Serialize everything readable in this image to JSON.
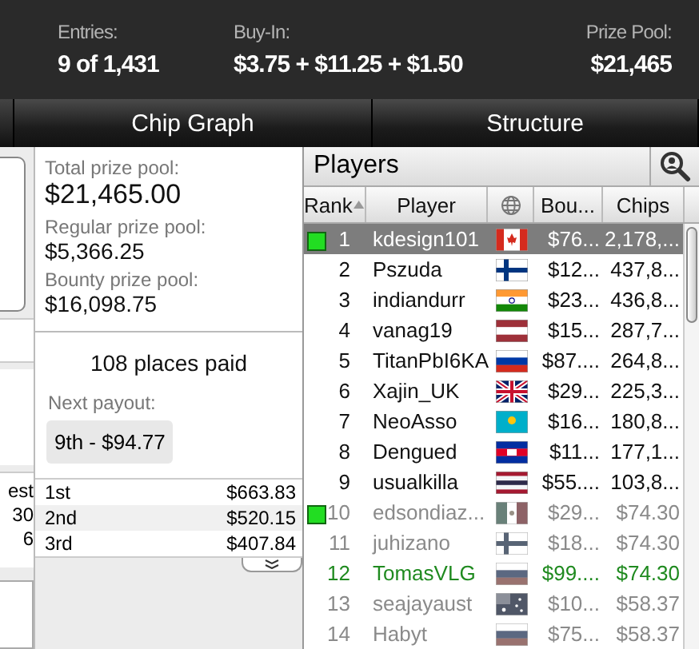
{
  "stats": [
    {
      "label": "Entries:",
      "value": "9 of 1,431"
    },
    {
      "label": "Buy-In:",
      "value": "$3.75 + $11.25 + $1.50"
    },
    {
      "label": "Prize Pool:",
      "value": "$21,465"
    }
  ],
  "tabs": [
    {
      "label": "Chip Graph",
      "selected": false
    },
    {
      "label": "Structure",
      "selected": false
    }
  ],
  "left_strip": {
    "texts": [
      "est",
      "30",
      "6"
    ]
  },
  "prize_info": {
    "items": [
      {
        "label": "Total prize pool:",
        "value": "$21,465.00"
      },
      {
        "label": "Regular prize pool:",
        "value": "$5,366.25"
      },
      {
        "label": "Bounty prize pool:",
        "value": "$16,098.75"
      }
    ],
    "places_paid": "108 places paid",
    "next_payout": {
      "label": "Next payout:",
      "value": "9th - $94.77"
    },
    "payouts": [
      {
        "place": "1st",
        "amount": "$663.83"
      },
      {
        "place": "2nd",
        "amount": "$520.15"
      },
      {
        "place": "3rd",
        "amount": "$407.84"
      }
    ]
  },
  "players": {
    "title": "Players",
    "columns": [
      {
        "kind": "text",
        "label": "Rank",
        "sorted": true
      },
      {
        "kind": "text",
        "label": "Player",
        "sorted": false
      },
      {
        "kind": "icon",
        "sorted": false
      },
      {
        "kind": "text",
        "label": "Bou...",
        "sorted": false
      },
      {
        "kind": "text",
        "label": "Chips",
        "sorted": false
      }
    ],
    "rows": [
      {
        "rank": "1",
        "name": "kdesign101",
        "flag": {
          "kind": "ca"
        },
        "bounty": "$76...",
        "chips": "2,178,...",
        "eliminated": false,
        "highlighted": false,
        "marked": true,
        "selected": true
      },
      {
        "rank": "2",
        "name": "Pszuda",
        "flag": {
          "kind": "fi"
        },
        "bounty": "$12...",
        "chips": "437,8...",
        "eliminated": false,
        "highlighted": false,
        "marked": false,
        "selected": false
      },
      {
        "rank": "3",
        "name": "indiandurr",
        "flag": {
          "kind": "in"
        },
        "bounty": "$23...",
        "chips": "436,8...",
        "eliminated": false,
        "highlighted": false,
        "marked": false,
        "selected": false
      },
      {
        "rank": "4",
        "name": "vanag19",
        "flag": {
          "kind": "lv"
        },
        "bounty": "$15...",
        "chips": "287,7...",
        "eliminated": false,
        "highlighted": false,
        "marked": false,
        "selected": false
      },
      {
        "rank": "5",
        "name": "TitanPbI6KA",
        "flag": {
          "kind": "ru"
        },
        "bounty": "$87....",
        "chips": "264,8...",
        "eliminated": false,
        "highlighted": false,
        "marked": false,
        "selected": false
      },
      {
        "rank": "6",
        "name": "Xajin_UK",
        "flag": {
          "kind": "gb"
        },
        "bounty": "$29...",
        "chips": "225,3...",
        "eliminated": false,
        "highlighted": false,
        "marked": false,
        "selected": false
      },
      {
        "rank": "7",
        "name": "NeoAsso",
        "flag": {
          "kind": "kz"
        },
        "bounty": "$16...",
        "chips": "180,8...",
        "eliminated": false,
        "highlighted": false,
        "marked": false,
        "selected": false
      },
      {
        "rank": "8",
        "name": "Dengued",
        "flag": {
          "kind": "kh"
        },
        "bounty": "$11...",
        "chips": "177,1...",
        "eliminated": false,
        "highlighted": false,
        "marked": false,
        "selected": false
      },
      {
        "rank": "9",
        "name": "usualkilla",
        "flag": {
          "kind": "th"
        },
        "bounty": "$55....",
        "chips": "103,8...",
        "eliminated": false,
        "highlighted": false,
        "marked": false,
        "selected": false
      },
      {
        "rank": "10",
        "name": "edsondiaz...",
        "flag": {
          "kind": "mx"
        },
        "bounty": "$29...",
        "chips": "$74.30",
        "eliminated": true,
        "highlighted": false,
        "marked": true,
        "selected": false
      },
      {
        "rank": "11",
        "name": "juhizano",
        "flag": {
          "kind": "fi"
        },
        "bounty": "$18...",
        "chips": "$74.30",
        "eliminated": true,
        "highlighted": false,
        "marked": false,
        "selected": false
      },
      {
        "rank": "12",
        "name": "TomasVLG",
        "flag": {
          "kind": "ru"
        },
        "bounty": "$99....",
        "chips": "$74.30",
        "eliminated": true,
        "highlighted": true,
        "marked": false,
        "selected": false
      },
      {
        "rank": "13",
        "name": "seajayaust",
        "flag": {
          "kind": "au"
        },
        "bounty": "$10...",
        "chips": "$58.37",
        "eliminated": true,
        "highlighted": false,
        "marked": false,
        "selected": false
      },
      {
        "rank": "14",
        "name": "Habyt",
        "flag": {
          "kind": "ru"
        },
        "bounty": "$75...",
        "chips": "$58.37",
        "eliminated": true,
        "highlighted": false,
        "marked": false,
        "selected": false
      }
    ]
  }
}
